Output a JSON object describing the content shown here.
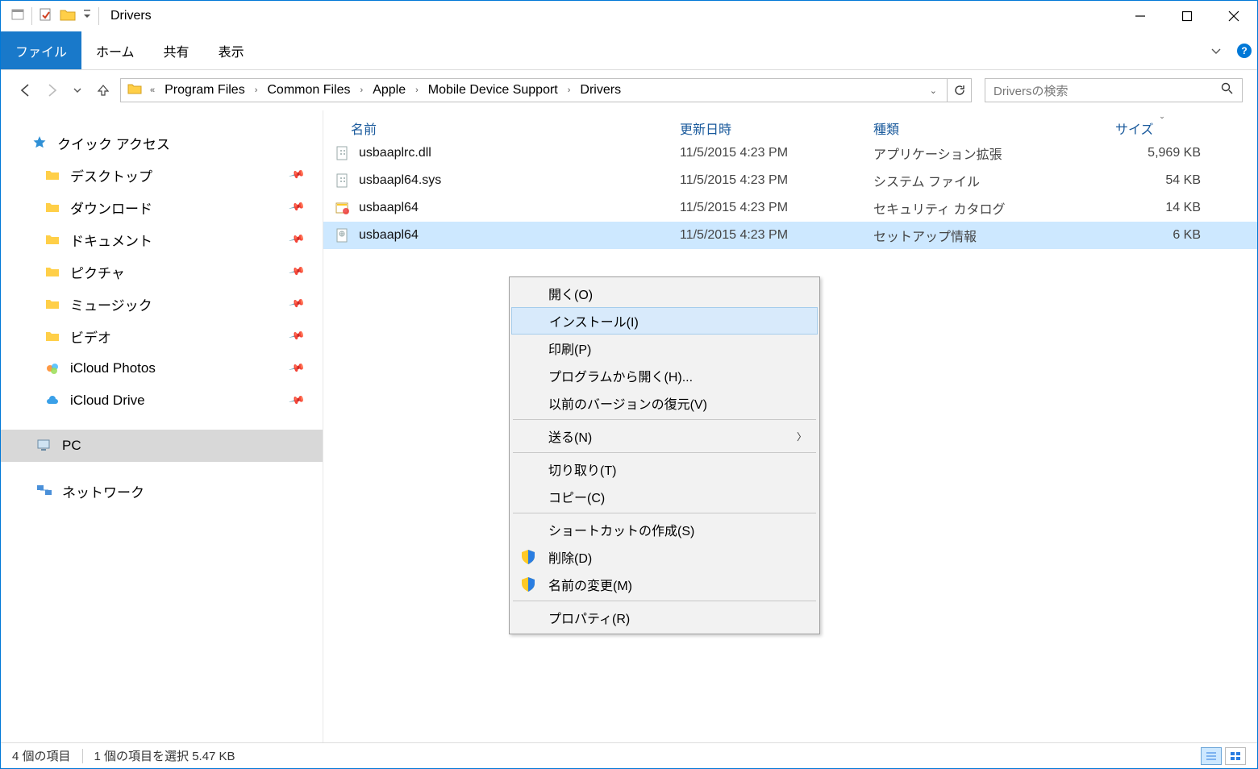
{
  "window": {
    "title": "Drivers"
  },
  "ribbon": {
    "file": "ファイル",
    "home": "ホーム",
    "share": "共有",
    "view": "表示"
  },
  "breadcrumb": {
    "items": [
      "Program Files",
      "Common Files",
      "Apple",
      "Mobile Device Support",
      "Drivers"
    ]
  },
  "search": {
    "placeholder": "Driversの検索"
  },
  "nav": {
    "quick_access": "クイック アクセス",
    "items": [
      {
        "label": "デスクトップ",
        "pinned": true
      },
      {
        "label": "ダウンロード",
        "pinned": true
      },
      {
        "label": "ドキュメント",
        "pinned": true
      },
      {
        "label": "ピクチャ",
        "pinned": true
      },
      {
        "label": "ミュージック",
        "pinned": true
      },
      {
        "label": "ビデオ",
        "pinned": true
      },
      {
        "label": "iCloud Photos",
        "pinned": true
      },
      {
        "label": "iCloud Drive",
        "pinned": true
      }
    ],
    "pc": "PC",
    "network": "ネットワーク"
  },
  "columns": {
    "name": "名前",
    "date": "更新日時",
    "type": "種類",
    "size": "サイズ"
  },
  "files": [
    {
      "name": "usbaaplrc.dll",
      "date": "11/5/2015 4:23 PM",
      "type": "アプリケーション拡張",
      "size": "5,969 KB"
    },
    {
      "name": "usbaapl64.sys",
      "date": "11/5/2015 4:23 PM",
      "type": "システム ファイル",
      "size": "54 KB"
    },
    {
      "name": "usbaapl64",
      "date": "11/5/2015 4:23 PM",
      "type": "セキュリティ カタログ",
      "size": "14 KB"
    },
    {
      "name": "usbaapl64",
      "date": "11/5/2015 4:23 PM",
      "type": "セットアップ情報",
      "size": "6 KB"
    }
  ],
  "selected_index": 3,
  "context_menu": {
    "open": "開く(O)",
    "install": "インストール(I)",
    "print": "印刷(P)",
    "open_with": "プログラムから開く(H)...",
    "restore_prev": "以前のバージョンの復元(V)",
    "send_to": "送る(N)",
    "cut": "切り取り(T)",
    "copy": "コピー(C)",
    "create_shortcut": "ショートカットの作成(S)",
    "delete": "削除(D)",
    "rename": "名前の変更(M)",
    "properties": "プロパティ(R)"
  },
  "status": {
    "item_count": "4 個の項目",
    "selection": "1 個の項目を選択 5.47 KB"
  }
}
